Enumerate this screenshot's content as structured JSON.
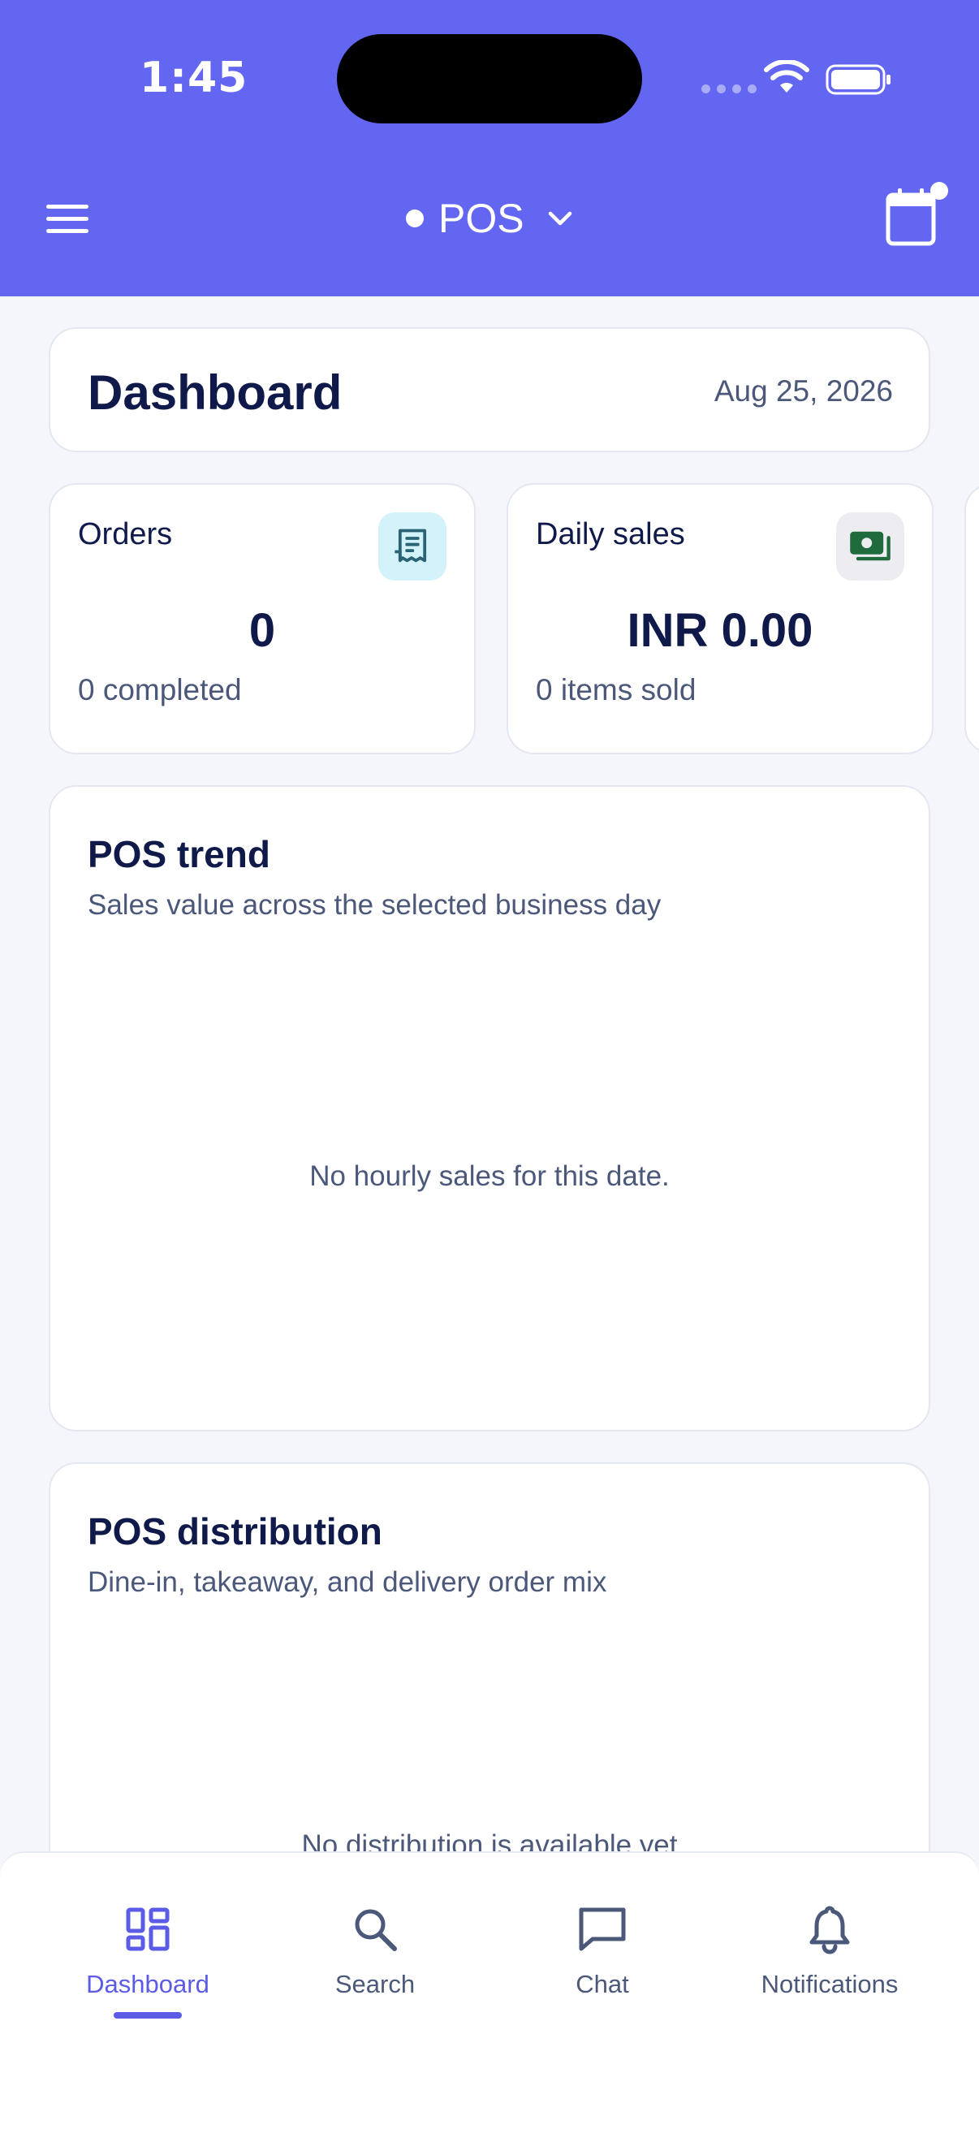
{
  "status_bar": {
    "time": "1:45"
  },
  "header": {
    "selector_label": "POS"
  },
  "dashboard": {
    "title": "Dashboard",
    "date": "Aug 25, 2026"
  },
  "stats": [
    {
      "title": "Orders",
      "value": "0",
      "subtitle": "0 completed",
      "icon": "receipt-icon"
    },
    {
      "title": "Daily sales",
      "value": "INR 0.00",
      "subtitle": "0 items sold",
      "icon": "cash-icon"
    }
  ],
  "trend": {
    "title": "POS trend",
    "subtitle": "Sales value across the selected business day",
    "empty_message": "No hourly sales for this date."
  },
  "distribution": {
    "title": "POS distribution",
    "subtitle": "Dine-in, takeaway, and delivery order mix",
    "empty_message": "No distribution is available yet"
  },
  "nav": {
    "items": [
      {
        "label": "Dashboard",
        "icon": "dashboard-icon",
        "active": true
      },
      {
        "label": "Search",
        "icon": "search-icon",
        "active": false
      },
      {
        "label": "Chat",
        "icon": "chat-icon",
        "active": false
      },
      {
        "label": "Notifications",
        "icon": "bell-icon",
        "active": false
      }
    ]
  },
  "colors": {
    "primary": "#6366f1",
    "active_nav": "#5b5be6",
    "text_dark": "#0f1a4a",
    "text_muted": "#4b587a",
    "background": "#f5f6fb"
  }
}
